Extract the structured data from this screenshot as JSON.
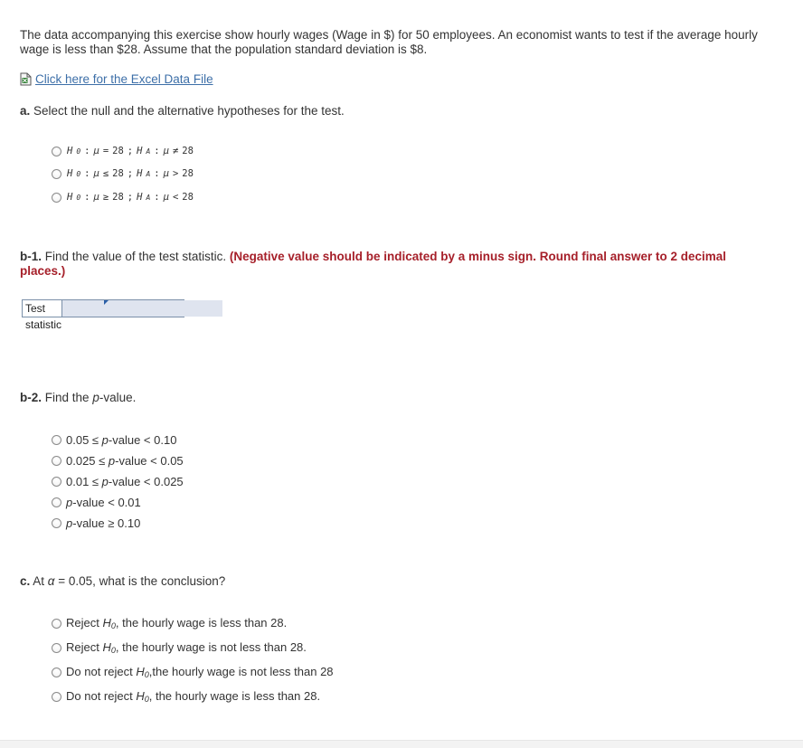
{
  "intro": {
    "text": "The data accompanying this exercise show hourly wages (Wage in $) for 50 employees. An economist wants to test if the average hourly wage is less than $28. Assume that the population standard deviation is $8."
  },
  "data_link": {
    "icon": "document-icon",
    "label": "Click here for the Excel Data File"
  },
  "part_a": {
    "prefix": "a.",
    "question": "Select the null and the alternative hypotheses for the test.",
    "options": [
      {
        "h0_op": "=",
        "ha_op": "≠",
        "value": "28"
      },
      {
        "h0_op": "≤",
        "ha_op": ">",
        "value": "28"
      },
      {
        "h0_op": "≥",
        "ha_op": "<",
        "value": "28"
      }
    ],
    "h0_label": "H",
    "h0_sub": "0",
    "ha_label": "H",
    "ha_sub": "A",
    "mu": "μ"
  },
  "part_b1": {
    "prefix": "b-1.",
    "question": "Find the value of the test statistic.",
    "hint": "(Negative value should be indicated by a minus sign. Round final answer to 2 decimal places.)",
    "field_label": "Test statistic",
    "field_value": ""
  },
  "part_b2": {
    "prefix": "b-2.",
    "question_pre": "Find the ",
    "question_italic": "p",
    "question_post": "-value.",
    "options": [
      {
        "pre": "0.05 ≤ ",
        "p": "p",
        "post": "-value < 0.10"
      },
      {
        "pre": "0.025 ≤ ",
        "p": "p",
        "post": "-value < 0.05"
      },
      {
        "pre": "0.01 ≤ ",
        "p": "p",
        "post": "-value < 0.025"
      },
      {
        "pre": "",
        "p": "p",
        "post": "-value < 0.01"
      },
      {
        "pre": "",
        "p": "p",
        "post": "-value ≥ 0.10"
      }
    ]
  },
  "part_c": {
    "prefix": "c.",
    "question_pre": "At ",
    "alpha": "α",
    "question_post": " = 0.05, what is the conclusion?",
    "options": [
      {
        "pre": "Reject ",
        "h": "H",
        "sub": "0",
        "post": ", the hourly wage is less than 28."
      },
      {
        "pre": "Reject ",
        "h": "H",
        "sub": "0",
        "post": ", the hourly wage is not less than 28."
      },
      {
        "pre": "Do not reject ",
        "h": "H",
        "sub": "0",
        "post": ",the hourly wage is not less than 28"
      },
      {
        "pre": "Do not reject ",
        "h": "H",
        "sub": "0",
        "post": ", the hourly wage is less than 28."
      }
    ]
  }
}
